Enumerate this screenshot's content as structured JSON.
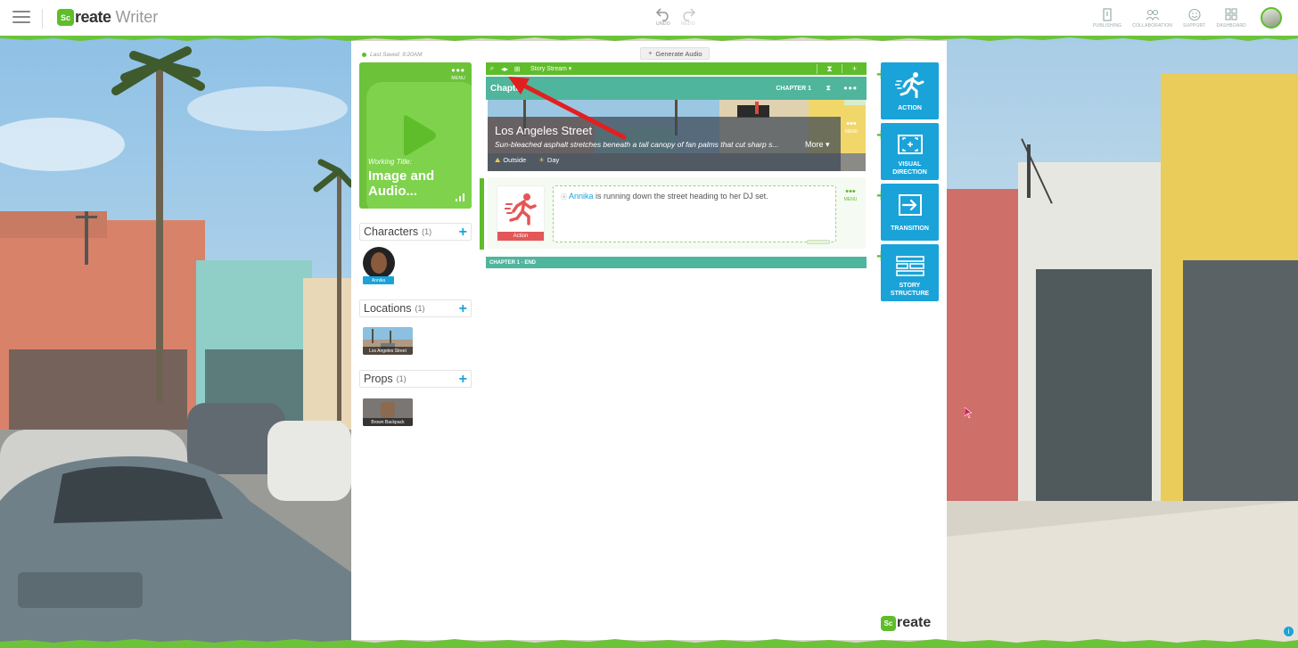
{
  "topbar": {
    "logo_badge": "Sc",
    "logo_text": "reate",
    "app_name": "Writer",
    "undo_label": "UNDO",
    "redo_label": "REDO",
    "publishing_label": "PUBLISHING",
    "collaboration_label": "COLLABORATION",
    "support_label": "SUPPORT",
    "dashboard_label": "DASHBOARD"
  },
  "status": {
    "last_saved": "Last Saved: 9:20AM"
  },
  "generate_audio": {
    "label": "Generate Audio"
  },
  "title_card": {
    "menu_label": "MENU",
    "working_title_label": "Working Title:",
    "title": "Image and Audio..."
  },
  "sidebar": {
    "characters": {
      "label": "Characters",
      "count": "(1)",
      "items": [
        {
          "name": "Annika"
        }
      ]
    },
    "locations": {
      "label": "Locations",
      "count": "(1)",
      "items": [
        {
          "name": "Los Angeles Street"
        }
      ]
    },
    "props": {
      "label": "Props",
      "count": "(1)",
      "items": [
        {
          "name": "Brown Backpack"
        }
      ]
    }
  },
  "story": {
    "toolbar": {
      "stream_label": "Story Stream ▾"
    },
    "chapter": {
      "label": "Chapter",
      "number_label": "CHAPTER 1",
      "end_label": "CHAPTER 1 - END"
    },
    "location": {
      "title": "Los Angeles Street",
      "description": "Sun-bleached asphalt stretches beneath a tall canopy of fan palms that cut sharp s...",
      "more_label": "More ▾",
      "menu_label": "MENU",
      "setting": "Outside",
      "time": "Day"
    },
    "action": {
      "label": "Action",
      "character": "Annika",
      "text": " is running down the street heading to her DJ set.",
      "menu_label": "MENU"
    }
  },
  "tools": [
    {
      "label": "ACTION"
    },
    {
      "label": "VISUAL DIRECTION"
    },
    {
      "label": "TRANSITION"
    },
    {
      "label": "STORY STRUCTURE"
    }
  ],
  "footer": {
    "logo_badge": "Sc",
    "logo_text": "reate",
    "help": "i"
  },
  "colors": {
    "brand_green": "#5fbd2b",
    "teal": "#4fb59c",
    "tool_blue": "#1aa3d8",
    "action_red": "#e35757"
  }
}
